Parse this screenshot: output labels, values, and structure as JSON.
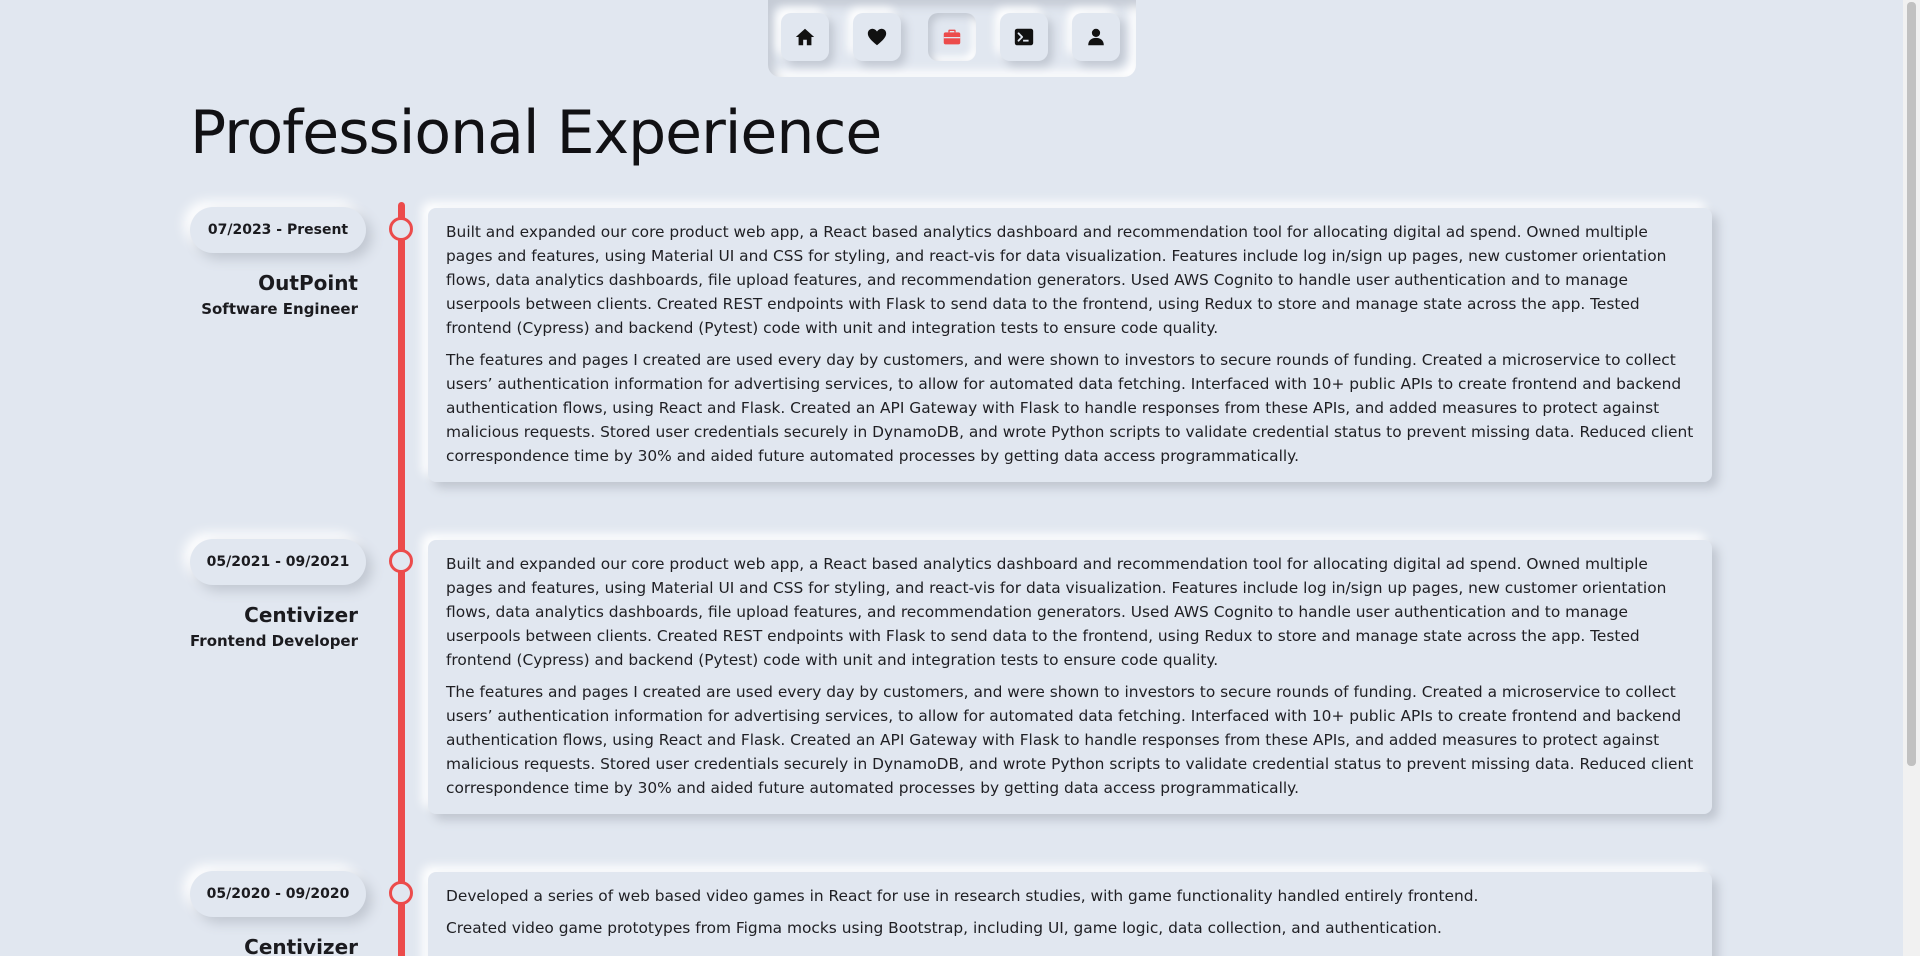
{
  "nav": {
    "items": [
      {
        "icon": "home-icon",
        "active": false
      },
      {
        "icon": "heart-icon",
        "active": false
      },
      {
        "icon": "briefcase-icon",
        "active": true
      },
      {
        "icon": "terminal-icon",
        "active": false
      },
      {
        "icon": "user-icon",
        "active": false
      }
    ],
    "accent_color": "#ec4b4b"
  },
  "page_title": "Professional Experience",
  "experience": [
    {
      "dates": "07/2023 - Present",
      "company": "OutPoint",
      "role": "Software Engineer",
      "paragraphs": [
        "Built and expanded our core product web app, a React based analytics dashboard and recommendation tool for allocating digital ad spend. Owned multiple pages and features, using Material UI and CSS for styling, and react-vis for data visualization. Features include log in/sign up pages, new customer orientation flows, data analytics dashboards, file upload features, and recommendation generators. Used AWS Cognito to handle user authentication and to manage userpools between clients. Created REST endpoints with Flask to send data to the frontend, using Redux to store and manage state across the app. Tested frontend (Cypress) and backend (Pytest) code with unit and integration tests to ensure code quality.",
        "The features and pages I created are used every day by customers, and were shown to investors to secure rounds of funding. Created a microservice to collect users’ authentication information for advertising services, to allow for automated data fetching. Interfaced with 10+ public APIs to create frontend and backend authentication flows, using React and Flask. Created an API Gateway with Flask to handle responses from these APIs, and added measures to protect against malicious requests. Stored user credentials securely in DynamoDB, and wrote Python scripts to validate credential status to prevent missing data. Reduced client correspondence time by 30% and aided future automated processes by getting data access programmatically."
      ]
    },
    {
      "dates": "05/2021 - 09/2021",
      "company": "Centivizer",
      "role": "Frontend Developer",
      "paragraphs": [
        "Built and expanded our core product web app, a React based analytics dashboard and recommendation tool for allocating digital ad spend. Owned multiple pages and features, using Material UI and CSS for styling, and react-vis for data visualization. Features include log in/sign up pages, new customer orientation flows, data analytics dashboards, file upload features, and recommendation generators. Used AWS Cognito to handle user authentication and to manage userpools between clients. Created REST endpoints with Flask to send data to the frontend, using Redux to store and manage state across the app. Tested frontend (Cypress) and backend (Pytest) code with unit and integration tests to ensure code quality.",
        "The features and pages I created are used every day by customers, and were shown to investors to secure rounds of funding. Created a microservice to collect users’ authentication information for advertising services, to allow for automated data fetching. Interfaced with 10+ public APIs to create frontend and backend authentication flows, using React and Flask. Created an API Gateway with Flask to handle responses from these APIs, and added measures to protect against malicious requests. Stored user credentials securely in DynamoDB, and wrote Python scripts to validate credential status to prevent missing data. Reduced client correspondence time by 30% and aided future automated processes by getting data access programmatically."
      ]
    },
    {
      "dates": "05/2020 - 09/2020",
      "company": "Centivizer",
      "role": "",
      "paragraphs": [
        "Developed a series of web based video games in React for use in research studies, with game functionality handled entirely frontend.",
        "Created video game prototypes from Figma mocks using Bootstrap, including UI, game logic, data collection, and authentication."
      ]
    }
  ]
}
